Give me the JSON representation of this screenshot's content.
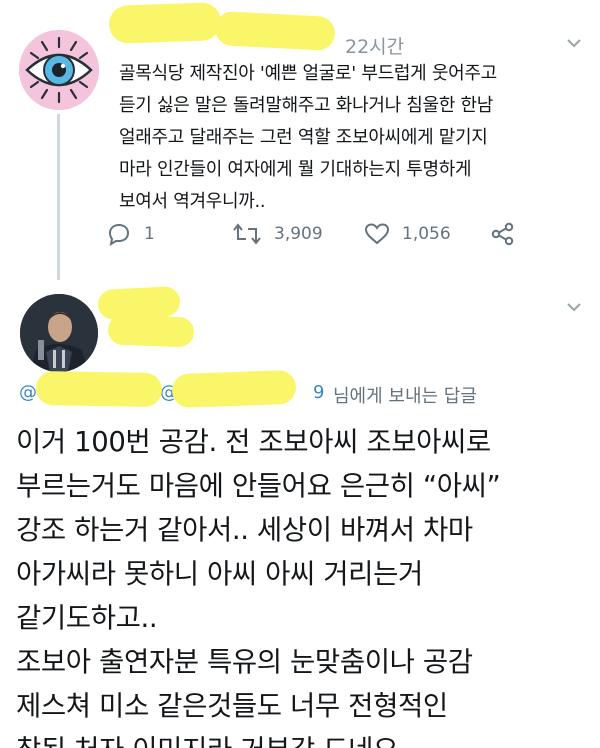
{
  "tweet1": {
    "avatar_icon": "eye-icon",
    "time": "22시간",
    "body_lines": [
      "골목식당 제작진아 '예쁜 얼굴로' 부드럽게 웃어주고",
      "듣기 싫은 말은 돌려말해주고 화나거나 침울한 한남",
      "얼래주고 달래주는 그런 역할 조보아씨에게 맡기지",
      "마라 인간들이 여자에게 뭘 기대하는지 투명하게",
      "보여서 역겨우니까.."
    ],
    "reply_count": "1",
    "retweet_count": "3,909",
    "like_count": "1,056"
  },
  "tweet2": {
    "reply_prefix_at1": "@",
    "reply_prefix_at2": "@",
    "reply_suffix_digit": "9",
    "reply_to_label": "님에게 보내는 답글",
    "body_lines": [
      "이거 100번 공감. 전 조보아씨 조보아씨로",
      "부르는거도 마음에 안들어요 은근히 “아씨”",
      "강조 하는거 같아서.. 세상이 바껴서 차마",
      "아가씨라 못하니 아씨 아씨 거리는거",
      "같기도하고..",
      "조보아 출연자분 특유의 눈맞춤이나 공감",
      "제스쳐 미소 같은것들도 너무 전형적인",
      "참된 처자 이미지라 거부감 드네요"
    ]
  },
  "colors": {
    "highlight_yellow": "#faf66a",
    "link_blue": "#3b86c6",
    "muted_gray": "#65737e",
    "avatar_pink": "#f4c4dc"
  }
}
